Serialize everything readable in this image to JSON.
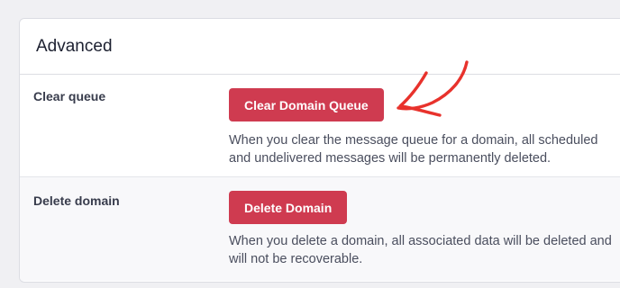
{
  "advanced": {
    "title": "Advanced",
    "rows": [
      {
        "label": "Clear queue",
        "button": "Clear Domain Queue",
        "description": "When you clear the message queue for a domain, all scheduled and undelivered messages will be permanently deleted."
      },
      {
        "label": "Delete domain",
        "button": "Delete Domain",
        "description": "When you delete a domain, all associated data will be deleted and will not be recoverable."
      }
    ]
  },
  "colors": {
    "danger_button": "#cf3b50",
    "annotation_arrow": "#e8322c",
    "page_background": "#f0f0f3"
  },
  "annotation": {
    "icon": "hand-drawn-arrow-icon"
  }
}
